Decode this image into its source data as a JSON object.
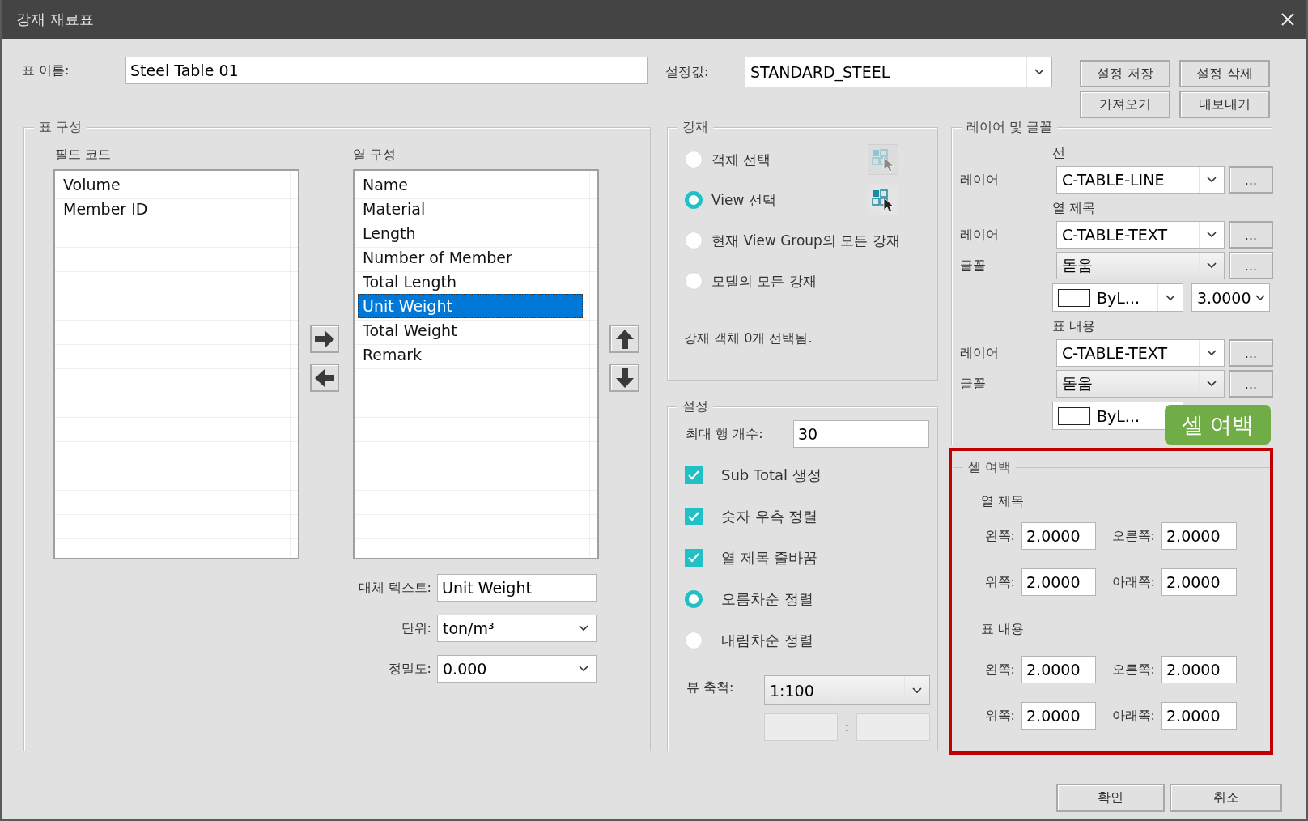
{
  "window": {
    "title": "강재 재료표"
  },
  "table_name": {
    "label": "표 이름:",
    "value": "Steel Table 01"
  },
  "preset": {
    "label": "설정값:",
    "value": "STANDARD_STEEL"
  },
  "preset_buttons": [
    "설정 저장",
    "설정 삭제",
    "가져오기",
    "내보내기"
  ],
  "table_config": {
    "title": "표 구성",
    "field_codes": {
      "label": "필드 코드",
      "items": [
        {
          "label": "Volume",
          "selected": false
        },
        {
          "label": "Member ID",
          "selected": false
        }
      ]
    },
    "columns": {
      "label": "열 구성",
      "items": [
        {
          "label": "Name",
          "selected": false
        },
        {
          "label": "Material",
          "selected": false
        },
        {
          "label": "Length",
          "selected": false
        },
        {
          "label": "Number of Member",
          "selected": false
        },
        {
          "label": "Total Length",
          "selected": false
        },
        {
          "label": "Unit Weight",
          "selected": true
        },
        {
          "label": "Total Weight",
          "selected": false
        },
        {
          "label": "Remark",
          "selected": false
        }
      ]
    },
    "alt_text": {
      "label": "대체 텍스트:",
      "value": "Unit Weight"
    },
    "unit": {
      "label": "단위:",
      "value": "ton/m³"
    },
    "precision": {
      "label": "정밀도:",
      "value": "0.000"
    }
  },
  "members": {
    "title": "강재",
    "options": [
      {
        "label": "객체 선택",
        "selected": false,
        "tool": {
          "disabled": true
        }
      },
      {
        "label": "View 선택",
        "selected": true,
        "tool": {
          "disabled": false
        }
      },
      {
        "label": "현재 View Group의 모든 강재",
        "selected": false
      },
      {
        "label": "모델의 모든 강재",
        "selected": false
      }
    ],
    "status": "강재 객체 0개 선택됨."
  },
  "settings": {
    "title": "설정",
    "max_rows": {
      "label": "최대 행 개수:",
      "value": "30"
    },
    "options": [
      {
        "kind": "check",
        "label": "Sub Total 생성",
        "checked": true
      },
      {
        "kind": "check",
        "label": "숫자 우측 정렬",
        "checked": true
      },
      {
        "kind": "check",
        "label": "열 제목 줄바꿈",
        "checked": true
      },
      {
        "kind": "radio",
        "label": "오름차순 정렬",
        "selected": true
      },
      {
        "kind": "radio",
        "label": "내림차순 정렬",
        "selected": false
      }
    ],
    "view_scale": {
      "label": "뷰 축척:",
      "value": "1:100",
      "separator": ":",
      "custom_disabled": true
    }
  },
  "layer_font": {
    "title": "레이어 및 글꼴",
    "sections": [
      {
        "heading": "선",
        "rows": [
          {
            "kind": "layer",
            "label": "레이어",
            "value": "C-TABLE-LINE",
            "more": "..."
          }
        ]
      },
      {
        "heading": "열 제목",
        "rows": [
          {
            "kind": "layer",
            "label": "레이어",
            "value": "C-TABLE-TEXT",
            "more": "..."
          },
          {
            "kind": "font",
            "label": "글꼴",
            "value": "돋움",
            "more": "..."
          },
          {
            "kind": "color_size",
            "color_label": "ByL...",
            "size": "3.0000"
          }
        ]
      },
      {
        "heading": "표 내용",
        "rows": [
          {
            "kind": "layer",
            "label": "레이어",
            "value": "C-TABLE-TEXT",
            "more": "..."
          },
          {
            "kind": "font",
            "label": "글꼴",
            "value": "돋움",
            "more": "..."
          },
          {
            "kind": "color_size",
            "color_label": "ByL..."
          }
        ]
      }
    ]
  },
  "cell_margin": {
    "title": "셀 여백",
    "highlighted": true,
    "sections": [
      {
        "heading": "열 제목",
        "fields": [
          {
            "label": "왼쪽:",
            "value": "2.0000"
          },
          {
            "label": "오른쪽:",
            "value": "2.0000"
          },
          {
            "label": "위쪽:",
            "value": "2.0000"
          },
          {
            "label": "아래쪽:",
            "value": "2.0000"
          }
        ]
      },
      {
        "heading": "표 내용",
        "fields": [
          {
            "label": "왼쪽:",
            "value": "2.0000"
          },
          {
            "label": "오른쪽:",
            "value": "2.0000"
          },
          {
            "label": "위쪽:",
            "value": "2.0000"
          },
          {
            "label": "아래쪽:",
            "value": "2.0000"
          }
        ]
      }
    ]
  },
  "callout": {
    "text": "셀 여백"
  },
  "footer_buttons": [
    "확인",
    "취소"
  ]
}
